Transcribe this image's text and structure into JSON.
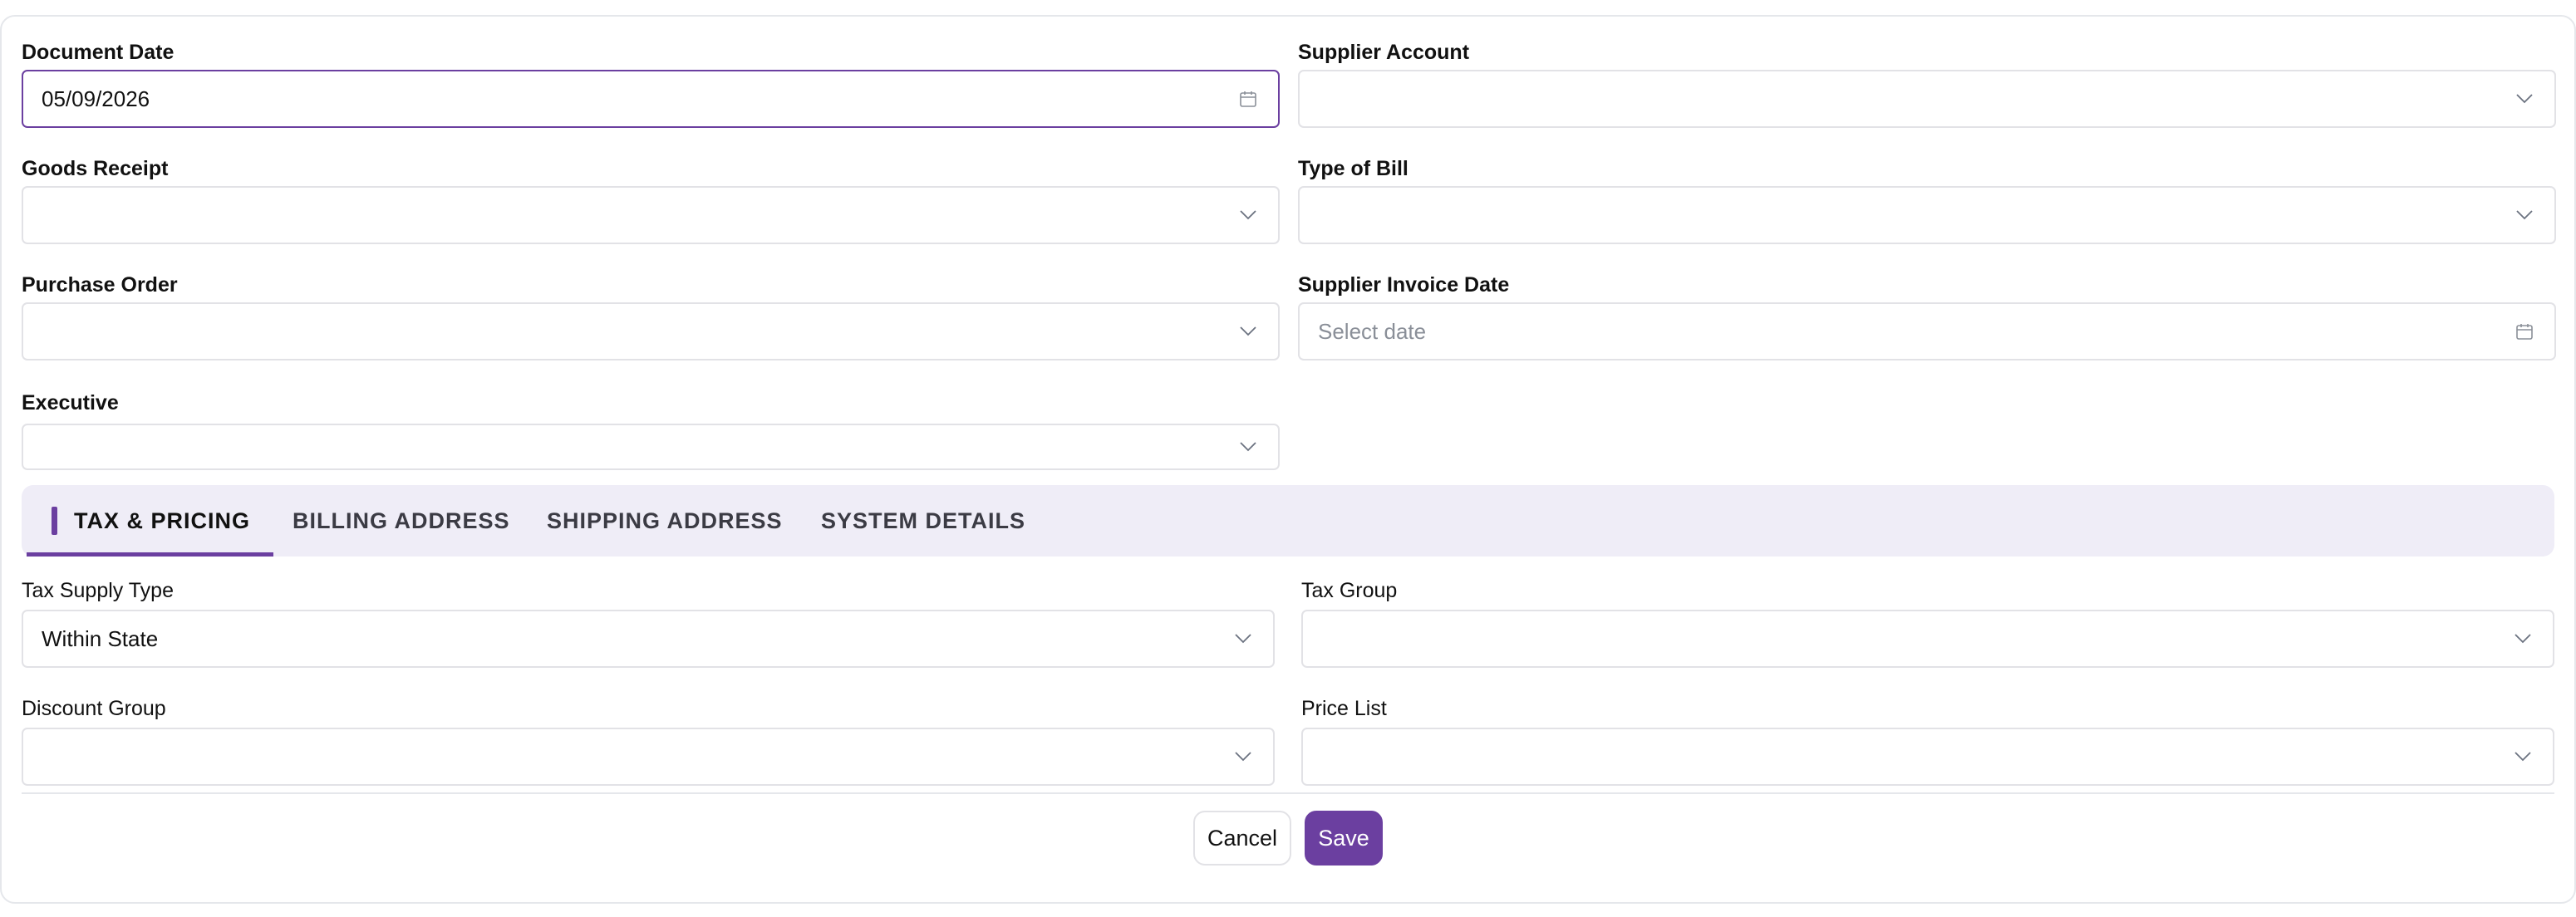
{
  "form": {
    "document_date": {
      "label": "Document Date",
      "value": "05/09/2026"
    },
    "supplier_account": {
      "label": "Supplier Account",
      "value": ""
    },
    "goods_receipt": {
      "label": "Goods Receipt",
      "value": ""
    },
    "type_of_bill": {
      "label": "Type of Bill",
      "value": ""
    },
    "purchase_order": {
      "label": "Purchase Order",
      "value": ""
    },
    "supplier_invoice_date": {
      "label": "Supplier Invoice Date",
      "placeholder": "Select date"
    },
    "executive": {
      "label": "Executive",
      "value": ""
    }
  },
  "tabs": [
    {
      "label": "TAX & PRICING",
      "active": true
    },
    {
      "label": "BILLING ADDRESS",
      "active": false
    },
    {
      "label": "SHIPPING ADDRESS",
      "active": false
    },
    {
      "label": "SYSTEM DETAILS",
      "active": false
    }
  ],
  "tax_pricing": {
    "tax_supply_type": {
      "label": "Tax Supply Type",
      "value": "Within State"
    },
    "tax_group": {
      "label": "Tax Group",
      "value": ""
    },
    "discount_group": {
      "label": "Discount Group",
      "value": ""
    },
    "price_list": {
      "label": "Price List",
      "value": ""
    }
  },
  "actions": {
    "cancel_label": "Cancel",
    "save_label": "Save"
  },
  "icons": {
    "calendar": "calendar-icon",
    "chevron": "chevron-down-icon"
  },
  "colors": {
    "accent": "#6b3fa0",
    "tab_bg": "#efedf7",
    "border": "#e2e2e6"
  }
}
